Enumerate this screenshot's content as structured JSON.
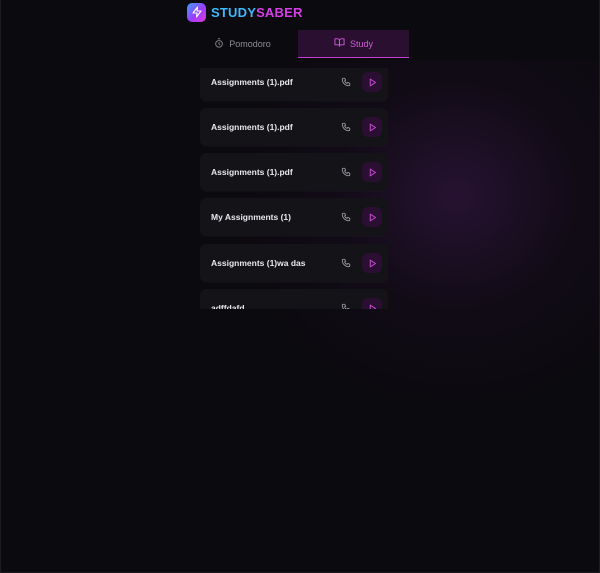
{
  "app": {
    "brand_part1": "STUDY",
    "brand_part2": "SABER",
    "logo_icon": "lightning-icon"
  },
  "tabs": [
    {
      "label": "Pomodoro",
      "icon": "timer-icon",
      "active": false
    },
    {
      "label": "Study",
      "icon": "book-open-icon",
      "active": true
    }
  ],
  "items": [
    {
      "title": "Assignments (1).pdf",
      "call_icon": "phone-icon",
      "play_icon": "play-icon"
    },
    {
      "title": "Assignments (1).pdf",
      "call_icon": "phone-icon",
      "play_icon": "play-icon"
    },
    {
      "title": "Assignments (1).pdf",
      "call_icon": "phone-icon",
      "play_icon": "play-icon"
    },
    {
      "title": "My Assignments (1)",
      "call_icon": "phone-icon",
      "play_icon": "play-icon"
    },
    {
      "title": "Assignments (1)wa das",
      "call_icon": "phone-icon",
      "play_icon": "play-icon"
    },
    {
      "title": "adffdafd",
      "call_icon": "phone-icon",
      "play_icon": "play-icon"
    }
  ],
  "colors": {
    "background": "#0b0a0e",
    "brand_blue": "#3fb8ff",
    "brand_magenta": "#d63ee8",
    "accent": "#c23fd2",
    "card": "#141317"
  }
}
